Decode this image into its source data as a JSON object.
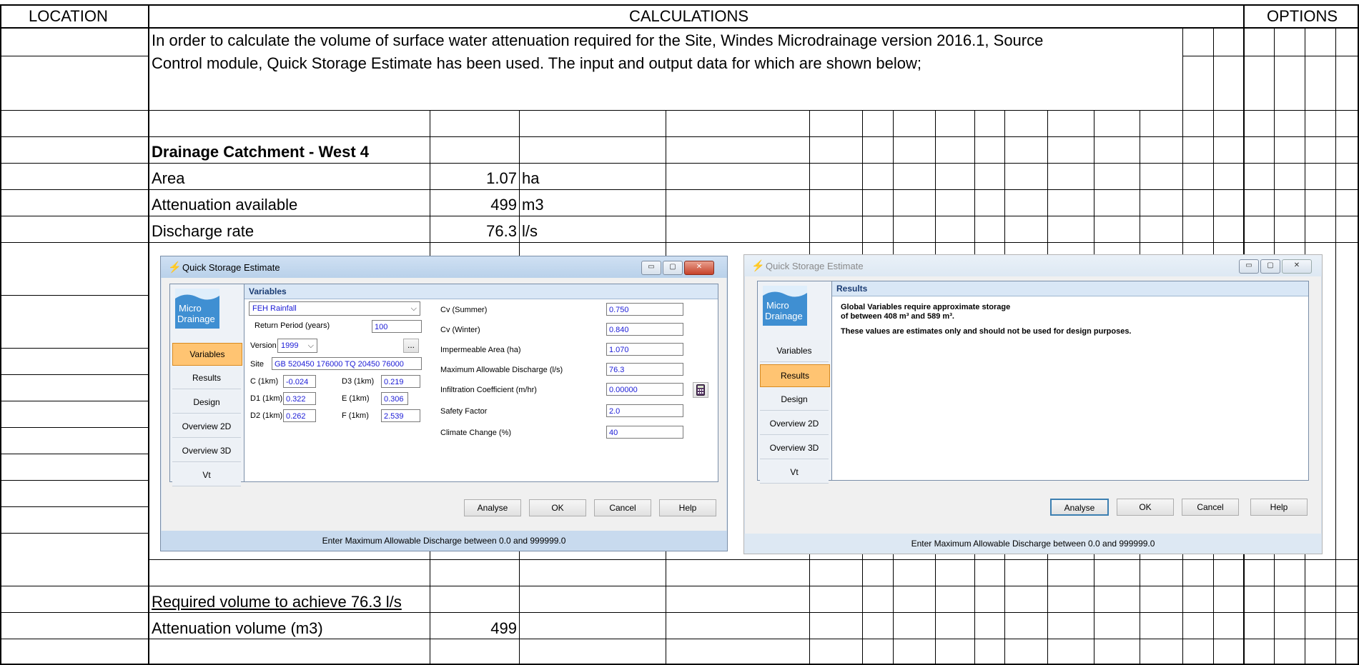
{
  "headers": {
    "location": "LOCATION",
    "calculations": "CALCULATIONS",
    "options": "OPTIONS"
  },
  "intro": {
    "line1": "In order to calculate the volume of surface water attenuation required for the Site, Windes Microdrainage version 2016.1, Source",
    "line2": "Control module, Quick Storage Estimate has been used. The input and output data for which are shown below;"
  },
  "catchment": {
    "title": "Drainage Catchment - West 4",
    "rows": [
      {
        "label": "Area",
        "value": "1.07",
        "unit": "ha"
      },
      {
        "label": "Attenuation available",
        "value": "499",
        "unit": "m3"
      },
      {
        "label": "Discharge rate",
        "value": "76.3",
        "unit": "l/s"
      }
    ]
  },
  "summary": {
    "heading": "Required volume to achieve 76.3 l/s",
    "label": "Attenuation volume (m3)",
    "value": "499"
  },
  "dialog_common": {
    "title": "Quick Storage Estimate",
    "logo_line1": "Micro",
    "logo_line2": "Drainage",
    "nav": [
      "Variables",
      "Results",
      "Design",
      "Overview 2D",
      "Overview 3D",
      "Vt"
    ],
    "buttons": {
      "analyse": "Analyse",
      "ok": "OK",
      "cancel": "Cancel",
      "help": "Help"
    },
    "status": "Enter Maximum Allowable Discharge between 0.0 and 999999.0",
    "window_buttons": {
      "minimize": "▭",
      "maximize": "▢",
      "close": "✕"
    }
  },
  "variables_dialog": {
    "section": "Variables",
    "rainfall": "FEH Rainfall",
    "return_period_label": "Return Period (years)",
    "return_period": "100",
    "version_label": "Version",
    "version": "1999",
    "ellipsis": "...",
    "site_label": "Site",
    "site": "GB 520450 176000 TQ 20450 76000",
    "c_label": "C (1km)",
    "c": "-0.024",
    "d1_label": "D1 (1km)",
    "d1": "0.322",
    "d2_label": "D2 (1km)",
    "d2": "0.262",
    "d3_label": "D3 (1km)",
    "d3": "0.219",
    "e_label": "E (1km)",
    "e": "0.306",
    "f_label": "F (1km)",
    "f": "2.539",
    "params": [
      {
        "label": "Cv (Summer)",
        "value": "0.750"
      },
      {
        "label": "Cv (Winter)",
        "value": "0.840"
      },
      {
        "label": "Impermeable Area (ha)",
        "value": "1.070"
      },
      {
        "label": "Maximum Allowable Discharge (l/s)",
        "value": "76.3"
      },
      {
        "label": "Infiltration Coefficient (m/hr)",
        "value": "0.00000"
      },
      {
        "label": "Safety Factor",
        "value": "2.0"
      },
      {
        "label": "Climate Change (%)",
        "value": "40"
      }
    ]
  },
  "results_dialog": {
    "section": "Results",
    "line1": "Global Variables require approximate storage",
    "line2": "of between 408 m³ and 589 m³.",
    "line3": "These values are estimates only and should not be used for design purposes."
  }
}
